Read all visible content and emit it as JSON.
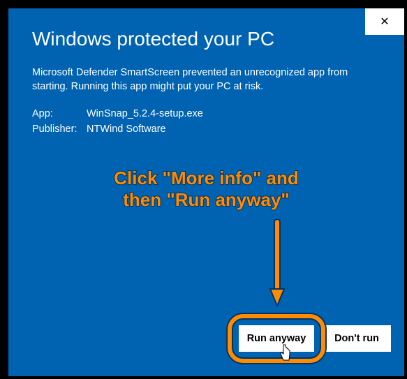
{
  "dialog": {
    "title": "Windows protected your PC",
    "description": "Microsoft Defender SmartScreen prevented an unrecognized app from starting. Running this app might put your PC at risk.",
    "app_label": "App:",
    "app_value": "WinSnap_5.2.4-setup.exe",
    "publisher_label": "Publisher:",
    "publisher_value": "NTWind Software",
    "run_button": "Run anyway",
    "dont_run_button": "Don't run",
    "close_glyph": "✕"
  },
  "annotation": {
    "line1": "Click \"More info\" and",
    "line2": "then \"Run anyway\"",
    "highlight_color": "#FF8C00"
  }
}
